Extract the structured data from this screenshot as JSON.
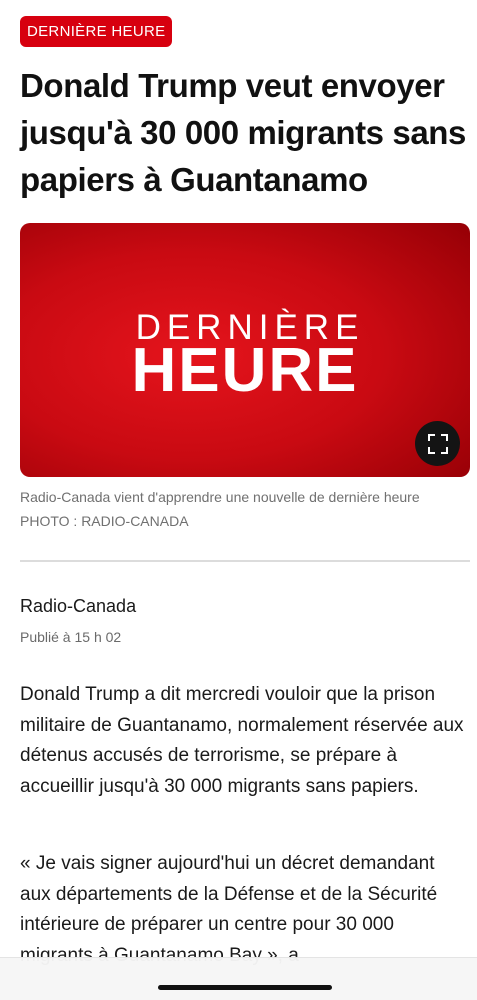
{
  "badge": {
    "label": "DERNIÈRE HEURE"
  },
  "article": {
    "headline": "Donald Trump veut envoyer jusqu'à 30 000 migrants sans papiers à Guantanamo",
    "hero": {
      "line1": "DERNIÈRE",
      "line2": "HEURE",
      "expand_icon": "expand-icon"
    },
    "caption": "Radio-Canada vient d'apprendre une nouvelle de dernière heure",
    "photo_credit": "PHOTO : RADIO-CANADA",
    "author": "Radio-Canada",
    "published": "Publié à 15 h 02",
    "paragraphs": [
      "Donald Trump a dit mercredi vouloir que la prison militaire de Guantanamo, normalement réservée aux détenus accusés de terrorisme, se prépare à accueillir jusqu'à 30 000 migrants sans papiers.",
      "« Je vais signer aujourd'hui un décret demandant aux départements de la Défense et de la Sécurité intérieure de préparer un centre pour 30 000 migrants à Guantanamo Bay », a"
    ]
  },
  "colors": {
    "accent": "#d7000f",
    "hero_red": "#c90a12",
    "text": "#1a1a1a",
    "muted": "#707070"
  }
}
